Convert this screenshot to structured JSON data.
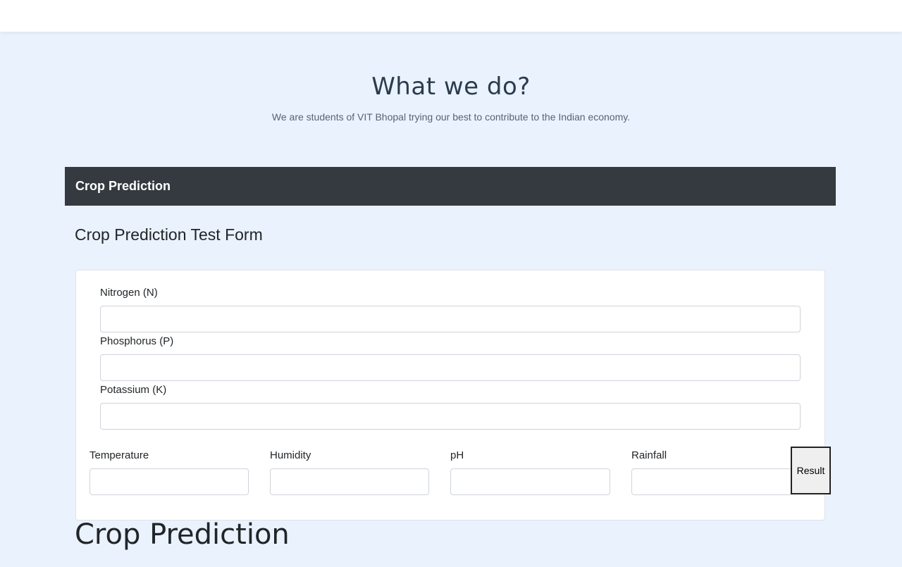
{
  "hero": {
    "title": "What we do?",
    "subtitle": "We are students of VIT Bhopal trying our best to contribute to the Indian economy."
  },
  "section": {
    "header": "Crop Prediction"
  },
  "form": {
    "heading": "Crop Prediction Test Form",
    "fields": {
      "nitrogen": {
        "label": "Nitrogen (N)",
        "value": ""
      },
      "phosphorus": {
        "label": "Phosphorus (P)",
        "value": ""
      },
      "potassium": {
        "label": "Potassium (K)",
        "value": ""
      },
      "temperature": {
        "label": "Temperature",
        "value": ""
      },
      "humidity": {
        "label": "Humidity",
        "value": ""
      },
      "ph": {
        "label": "pH",
        "value": ""
      },
      "rainfall": {
        "label": "Rainfall",
        "value": ""
      }
    },
    "submit_label": "Result"
  },
  "bottom": {
    "title": "Crop Prediction"
  },
  "colors": {
    "page_background": "#eaf2fd",
    "header_background": "#343a40",
    "header_text": "#ffffff",
    "hero_title": "#2b3c4e"
  }
}
